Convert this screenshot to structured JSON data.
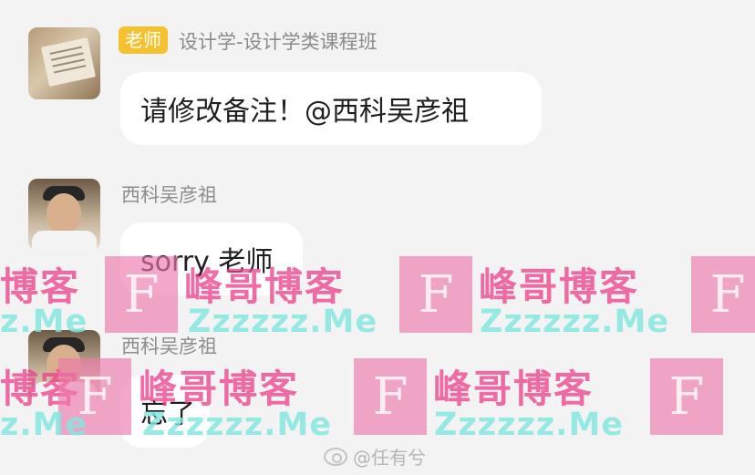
{
  "messages": [
    {
      "role_badge": "老师",
      "sender": "设计学-设计学类课程班",
      "text": "请修改备注！@西科吴彦祖"
    },
    {
      "sender": "西科吴彦祖",
      "text": "sorry 老师"
    },
    {
      "sender": "西科吴彦祖",
      "text": "忘了"
    }
  ],
  "watermark": {
    "logo_letter": "F",
    "title": "峰哥博客",
    "title_partial": "博客",
    "site": "Zzzzzz.Me",
    "site_partial": "z.Me"
  },
  "footer": {
    "handle": "@任有兮"
  },
  "colors": {
    "background": "#f3f3f3",
    "bubble": "#ffffff",
    "badge": "#f6c12f",
    "name_text": "#8e8e8e",
    "watermark_title": "#eb438c",
    "watermark_site": "#81e7de"
  }
}
